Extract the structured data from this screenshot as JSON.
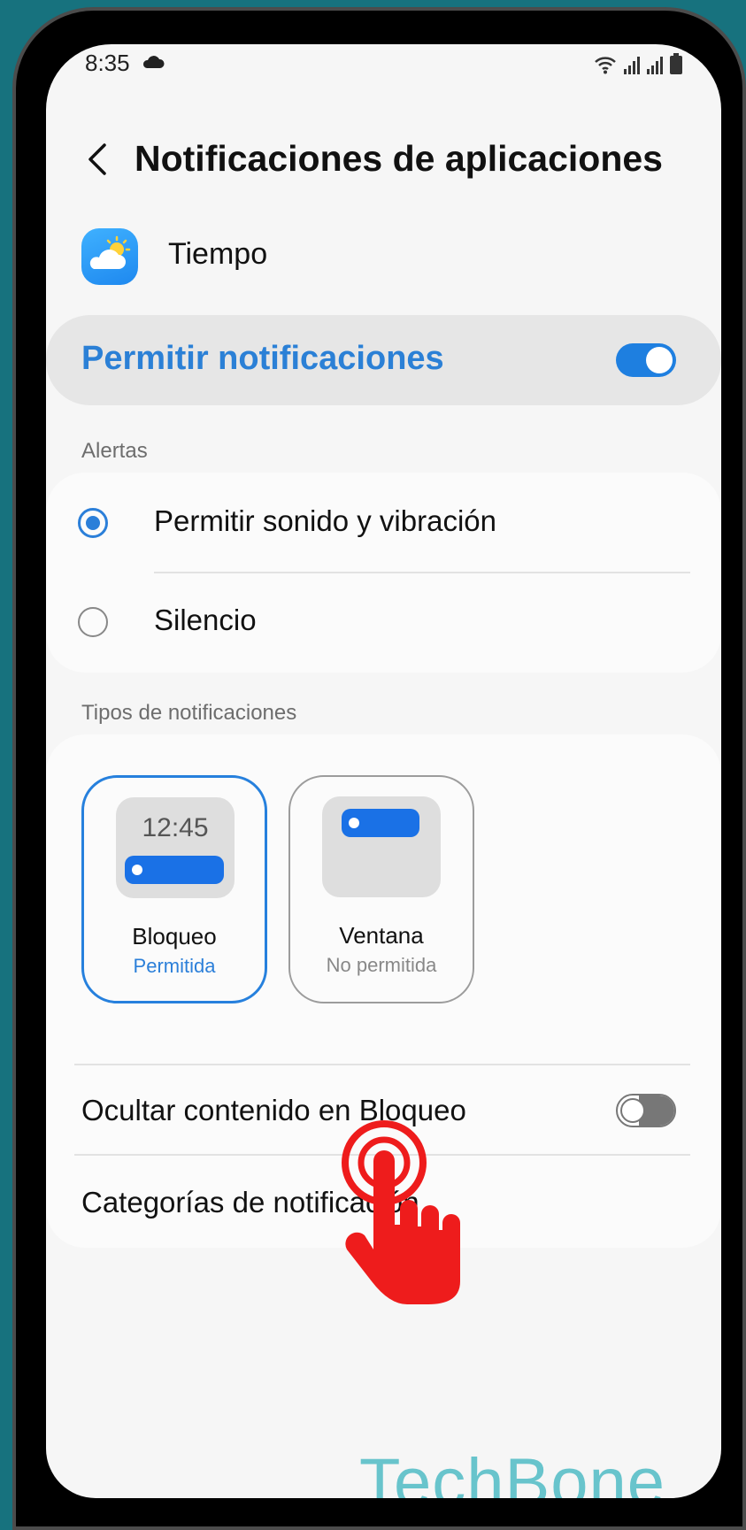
{
  "status_bar": {
    "time": "8:35",
    "icons": [
      "cloud-icon",
      "wifi-icon",
      "signal-icon",
      "signal-icon",
      "battery-icon"
    ]
  },
  "header": {
    "back_icon": "chevron-left-icon",
    "title": "Notificaciones de aplicaciones"
  },
  "app": {
    "name": "Tiempo",
    "icon": "weather-app-icon"
  },
  "allow_notifications": {
    "label": "Permitir notificaciones",
    "enabled": true
  },
  "alerts": {
    "section_label": "Alertas",
    "options": [
      {
        "label": "Permitir sonido y vibración",
        "selected": true
      },
      {
        "label": "Silencio",
        "selected": false
      }
    ]
  },
  "notification_types": {
    "section_label": "Tipos de notificaciones",
    "tiles": [
      {
        "title": "Bloqueo",
        "status": "Permitida",
        "preview_time": "12:45",
        "selected": true
      },
      {
        "title": "Ventana",
        "status": "No permitida",
        "selected": false
      }
    ]
  },
  "hide_content": {
    "label": "Ocultar contenido en Bloqueo",
    "enabled": false
  },
  "categories": {
    "label": "Categorías de notificación"
  },
  "watermark": "TechBone",
  "colors": {
    "accent": "#1e7fe0",
    "accent_text": "#2b80d6",
    "tap_indicator": "#ee1c1c",
    "background": "#17727e"
  }
}
